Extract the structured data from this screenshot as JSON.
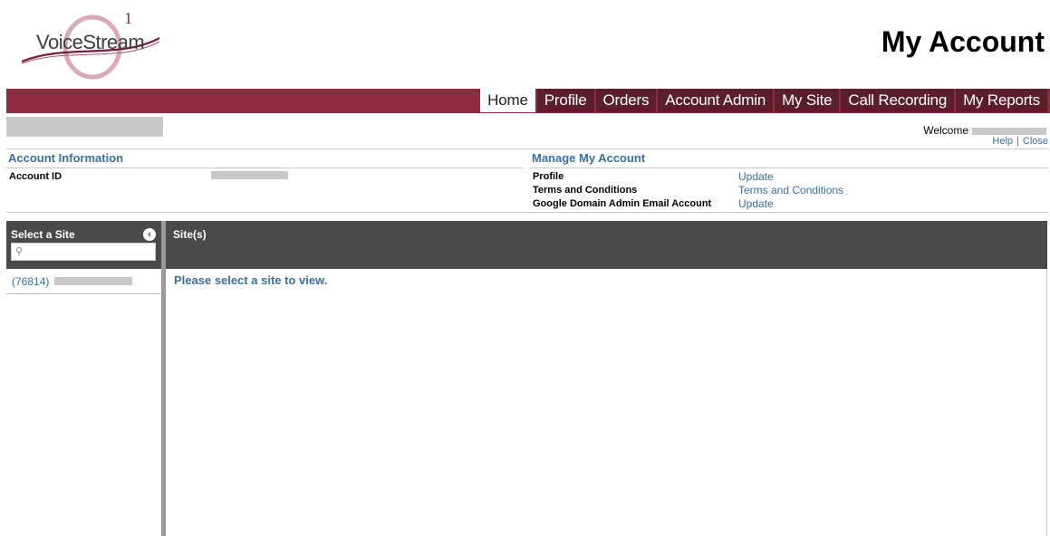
{
  "logo": {
    "text": "VoiceStream",
    "superscript": "1"
  },
  "page_title": "My Account",
  "nav": {
    "tabs": [
      "Home",
      "Profile",
      "Orders",
      "Account Admin",
      "My Site",
      "Call Recording",
      "My Reports"
    ],
    "active": "Home"
  },
  "header": {
    "welcome_label": "Welcome",
    "help_label": "Help",
    "close_label": "Close"
  },
  "account_info": {
    "title": "Account Information",
    "account_id_label": "Account ID"
  },
  "manage": {
    "title": "Manage My Account",
    "rows": [
      {
        "label": "Profile",
        "link": "Update"
      },
      {
        "label": "Terms and Conditions",
        "link": "Terms and Conditions"
      },
      {
        "label": "Google Domain Admin Email Account",
        "link": "Update"
      }
    ]
  },
  "sidebar": {
    "title": "Select a Site",
    "search_placeholder": "",
    "sites": [
      {
        "id": "(76814)"
      }
    ]
  },
  "main": {
    "title": "Site(s)",
    "message": "Please select a site to view."
  },
  "colors": {
    "nav_bar": "#8e2c44",
    "tab_bg": "#5a1e2c",
    "link": "#3a6ea5",
    "panel_header": "#4a4a4a"
  }
}
